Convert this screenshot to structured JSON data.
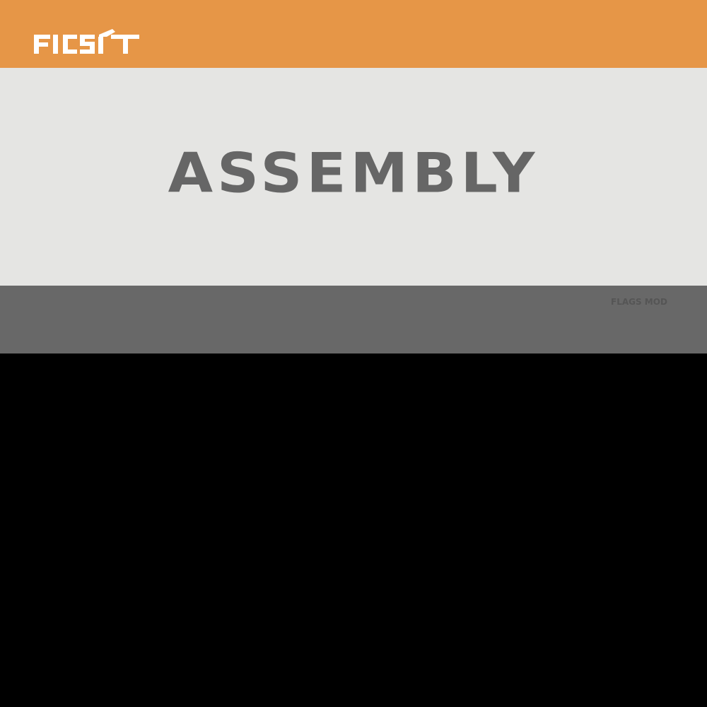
{
  "header": {
    "logo_text": "FICSIT",
    "color": "#E69647",
    "logo_color": "#FFFFFF"
  },
  "panel": {
    "title": "ASSEMBLY",
    "background": "#E5E5E3",
    "title_color": "#666666"
  },
  "footer": {
    "label": "FLAGS MOD",
    "background": "#686868",
    "label_color": "#555555"
  },
  "lower": {
    "background": "#000000"
  }
}
